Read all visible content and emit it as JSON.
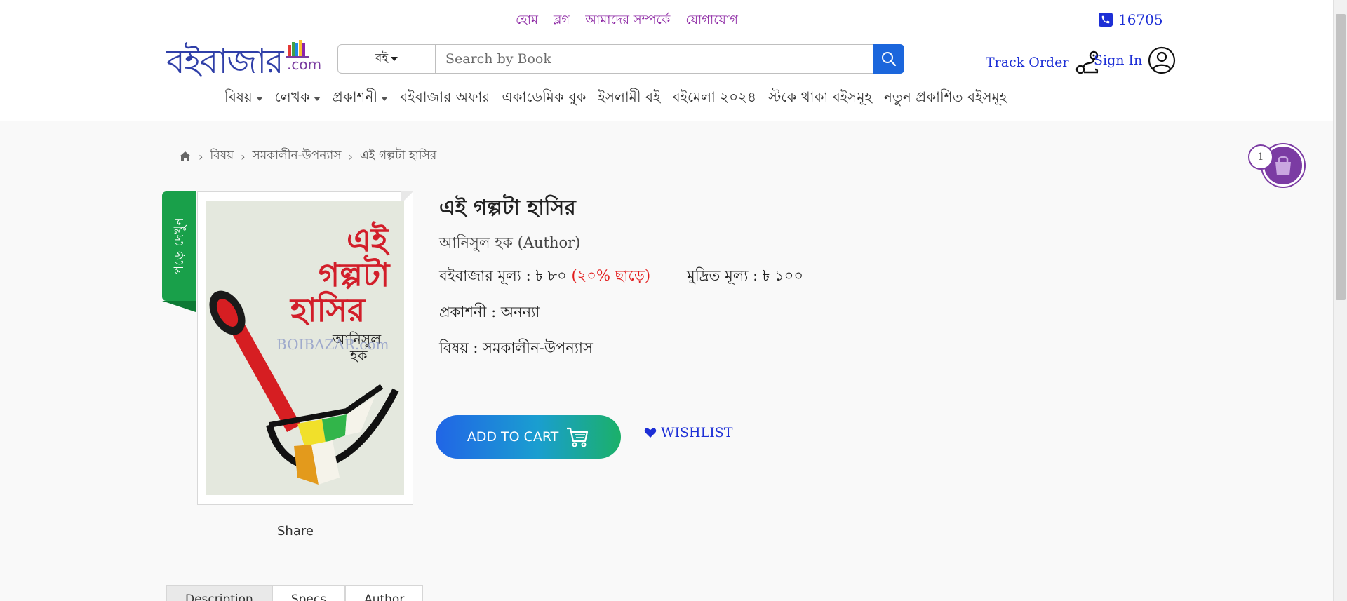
{
  "top_links": [
    "হোম",
    "ব্লগ",
    "আমাদের সম্পর্কে",
    "যোগাযোগ"
  ],
  "hotline": "16705",
  "logo": {
    "main": "বইবাজার",
    "suffix": ".com"
  },
  "search": {
    "category": "বই",
    "placeholder": "Search by Book",
    "value": ""
  },
  "track_order": "Track Order",
  "sign_in": "Sign In",
  "nav": [
    {
      "label": "বিষয়",
      "dropdown": true
    },
    {
      "label": "লেখক",
      "dropdown": true
    },
    {
      "label": "প্রকাশনী",
      "dropdown": true
    },
    {
      "label": "বইবাজার অফার",
      "dropdown": false
    },
    {
      "label": "একাডেমিক বুক",
      "dropdown": false
    },
    {
      "label": "ইসলামী বই",
      "dropdown": false
    },
    {
      "label": "বইমেলা ২০২৪",
      "dropdown": false
    },
    {
      "label": "স্টকে থাকা বইসমূহ",
      "dropdown": false
    },
    {
      "label": "নতুন প্রকাশিত বইসমূহ",
      "dropdown": false
    }
  ],
  "breadcrumb": [
    "বিষয়",
    "সমকালীন-উপন্যাস",
    "এই গল্পটা হাসির"
  ],
  "cart_count": "1",
  "read_label": "পড়ে দেখুন",
  "cover": {
    "title_line1": "এই",
    "title_line2": "গল্পটা",
    "title_line3": "হাসির",
    "author_line1": "আনিসুল",
    "author_line2": "হক",
    "watermark": "BOIBAZAR.com"
  },
  "share_label": "Share",
  "book": {
    "title": "এই গল্পটা হাসির",
    "author": "আনিসুল হক (Author)",
    "price_label": "বইবাজার মূল্য",
    "price_value": ": ৳ ৮০",
    "discount": "(২০% ছাড়ে)",
    "print_label": "মুদ্রিত মূল্য",
    "print_value": ": ৳ ১০০",
    "publisher_label": "প্রকাশনী",
    "publisher_value": ": অনন্যা",
    "subject_label": "বিষয়",
    "subject_value": ": সমকালীন-উপন্যাস"
  },
  "add_to_cart": "ADD TO CART",
  "wishlist": "WISHLIST",
  "tabs": [
    "Description",
    "Specs",
    "Author"
  ],
  "colors": {
    "brand_blue": "#1d2fd6",
    "brand_purple": "#7b3ba3",
    "discount_red": "#e21d1d",
    "read_green": "#19a04a"
  }
}
